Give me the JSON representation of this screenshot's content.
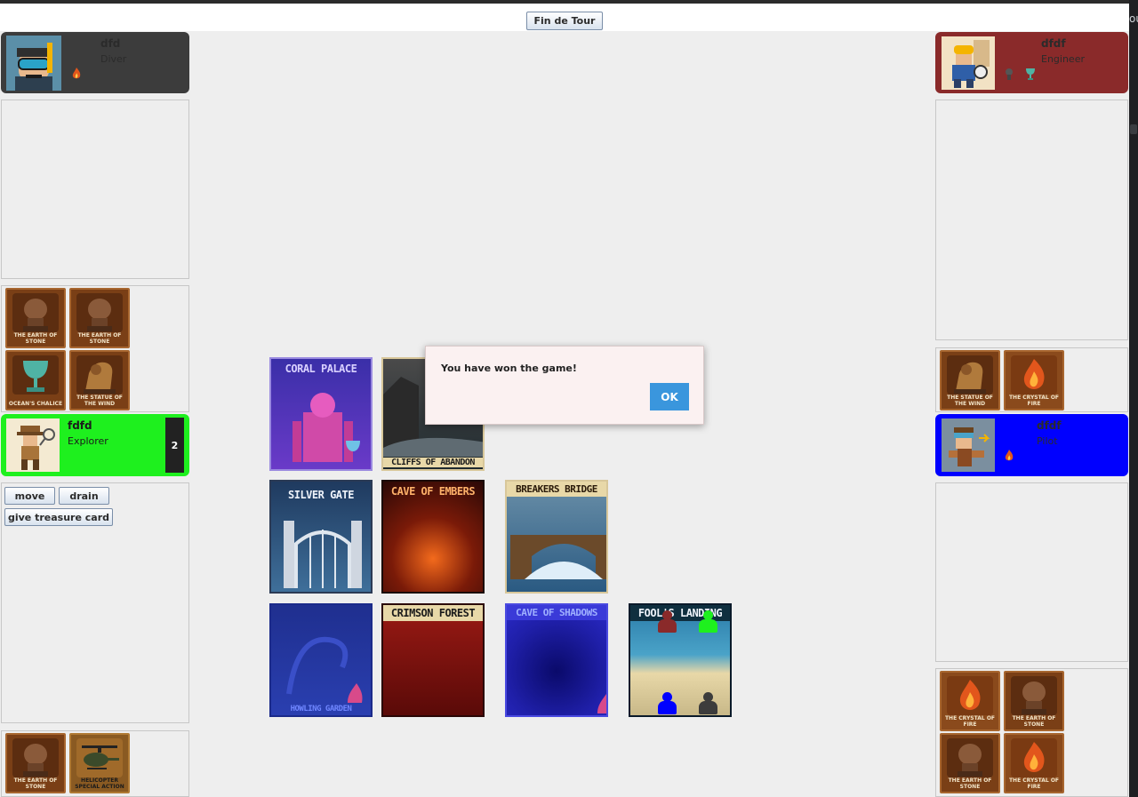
{
  "toolbar": {
    "end_turn_label": "Fin de Tour"
  },
  "players": {
    "diver": {
      "name": "dfd",
      "role": "Diver",
      "color": "#3c3c3c"
    },
    "engineer": {
      "name": "dfdf",
      "role": "Engineer",
      "color": "#8a2a2a"
    },
    "explorer": {
      "name": "fdfd",
      "role": "Explorer",
      "color": "#1ef01e",
      "actions_left": "2"
    },
    "pilot": {
      "name": "dfdf",
      "role": "Pilot",
      "color": "#0000ff"
    }
  },
  "left_hand": {
    "cards": [
      "THE EARTH OF STONE",
      "THE EARTH OF STONE",
      "OCEAN'S CHALICE",
      "THE STATUE OF THE WIND"
    ],
    "bottom_cards": [
      "THE EARTH OF STONE",
      "HELICOPTER SPECIAL ACTION"
    ]
  },
  "right_hand": {
    "cards": [
      "THE STATUE OF THE WIND",
      "THE CRYSTAL OF FIRE"
    ],
    "bottom_cards": [
      "THE CRYSTAL OF FIRE",
      "THE EARTH OF STONE",
      "THE EARTH OF STONE",
      "THE CRYSTAL OF FIRE"
    ]
  },
  "actions": {
    "move": "move",
    "drain": "drain",
    "give": "give treasure card"
  },
  "tiles": [
    "CORAL PALACE",
    "CLIFFS OF ABANDON",
    "SILVER GATE",
    "CAVE OF EMBERS",
    "BREAKERS BRIDGE",
    "HOWLING GARDEN",
    "CRIMSON FOREST",
    "CAVE OF SHADOWS",
    "FOOL'S LANDING"
  ],
  "dialog": {
    "message": "You have won the game!",
    "ok_label": "OK"
  },
  "colors": {
    "accent": "#3a96dd",
    "background": "#eeeeee"
  }
}
